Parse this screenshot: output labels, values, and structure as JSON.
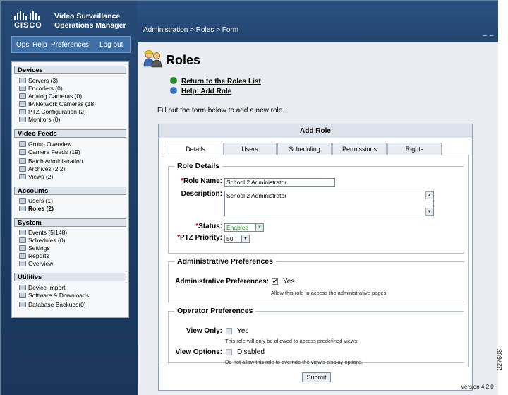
{
  "brand": {
    "company": "CISCO",
    "product_line1": "Video Surveillance",
    "product_line2": "Operations Manager"
  },
  "topmenu": {
    "ops": "Ops",
    "help": "Help",
    "preferences": "Preferences",
    "logout": "Log out"
  },
  "header": {
    "breadcrumb": "Administration > Roles > Form",
    "window_controls": "_ _"
  },
  "sidebar": {
    "devices": {
      "title": "Devices",
      "items": [
        "Servers (3)",
        "Encoders (0)",
        "Analog Cameras (0)",
        "IP/Network Cameras (18)",
        "PTZ Configuration (2)",
        "Monitors (0)"
      ]
    },
    "video_feeds": {
      "title": "Video Feeds",
      "items": [
        "Group Overview",
        "Camera Feeds (19)",
        "Batch Administration",
        "Archives (2|2)",
        "Views (2)"
      ]
    },
    "accounts": {
      "title": "Accounts",
      "items": [
        "Users (1)",
        "Roles (2)"
      ]
    },
    "system": {
      "title": "System",
      "items": [
        "Events (5|148)",
        "Schedules (0)",
        "Settings",
        "Reports",
        "Overview"
      ]
    },
    "utilities": {
      "title": "Utilities",
      "items": [
        "Device Import",
        "Software & Downloads",
        "Database Backups(0)"
      ]
    }
  },
  "main": {
    "title": "Roles",
    "link_return": "Return to the Roles List",
    "link_help": "Help: Add Role",
    "intro": "Fill out the form below to add a new role."
  },
  "form": {
    "title": "Add Role",
    "tabs": [
      "Details",
      "Users",
      "Scheduling",
      "Permissions",
      "Rights"
    ],
    "role_details": {
      "legend": "Role Details",
      "role_name_label": "Role Name:",
      "role_name_value": "School 2 Administrator",
      "description_label": "Description:",
      "description_value": "School 2 Administrator",
      "status_label": "Status:",
      "status_value": "Enabled",
      "ptz_label": "PTZ Priority:",
      "ptz_value": "50",
      "required_mark": "*"
    },
    "admin_prefs": {
      "legend": "Administrative Preferences",
      "label": "Administrative Preferences:",
      "checked": true,
      "check_mark": "✔",
      "option": "Yes",
      "help": "Allow this role to access the administrative pages."
    },
    "operator_prefs": {
      "legend": "Operator Preferences",
      "view_only_label": "View Only:",
      "view_only_option": "Yes",
      "view_only_help": "This role will only be allowed to access predefined views.",
      "view_options_label": "View Options:",
      "view_options_option": "Disabled",
      "view_options_help": "Do not allow this role to override the view's display options."
    },
    "submit": "Submit"
  },
  "footer": {
    "version": "Version 4.2.0",
    "figure_number": "227698"
  },
  "colors": {
    "navy": "#23466f",
    "accent_green": "#2e8b2e",
    "required": "#cc0000"
  }
}
